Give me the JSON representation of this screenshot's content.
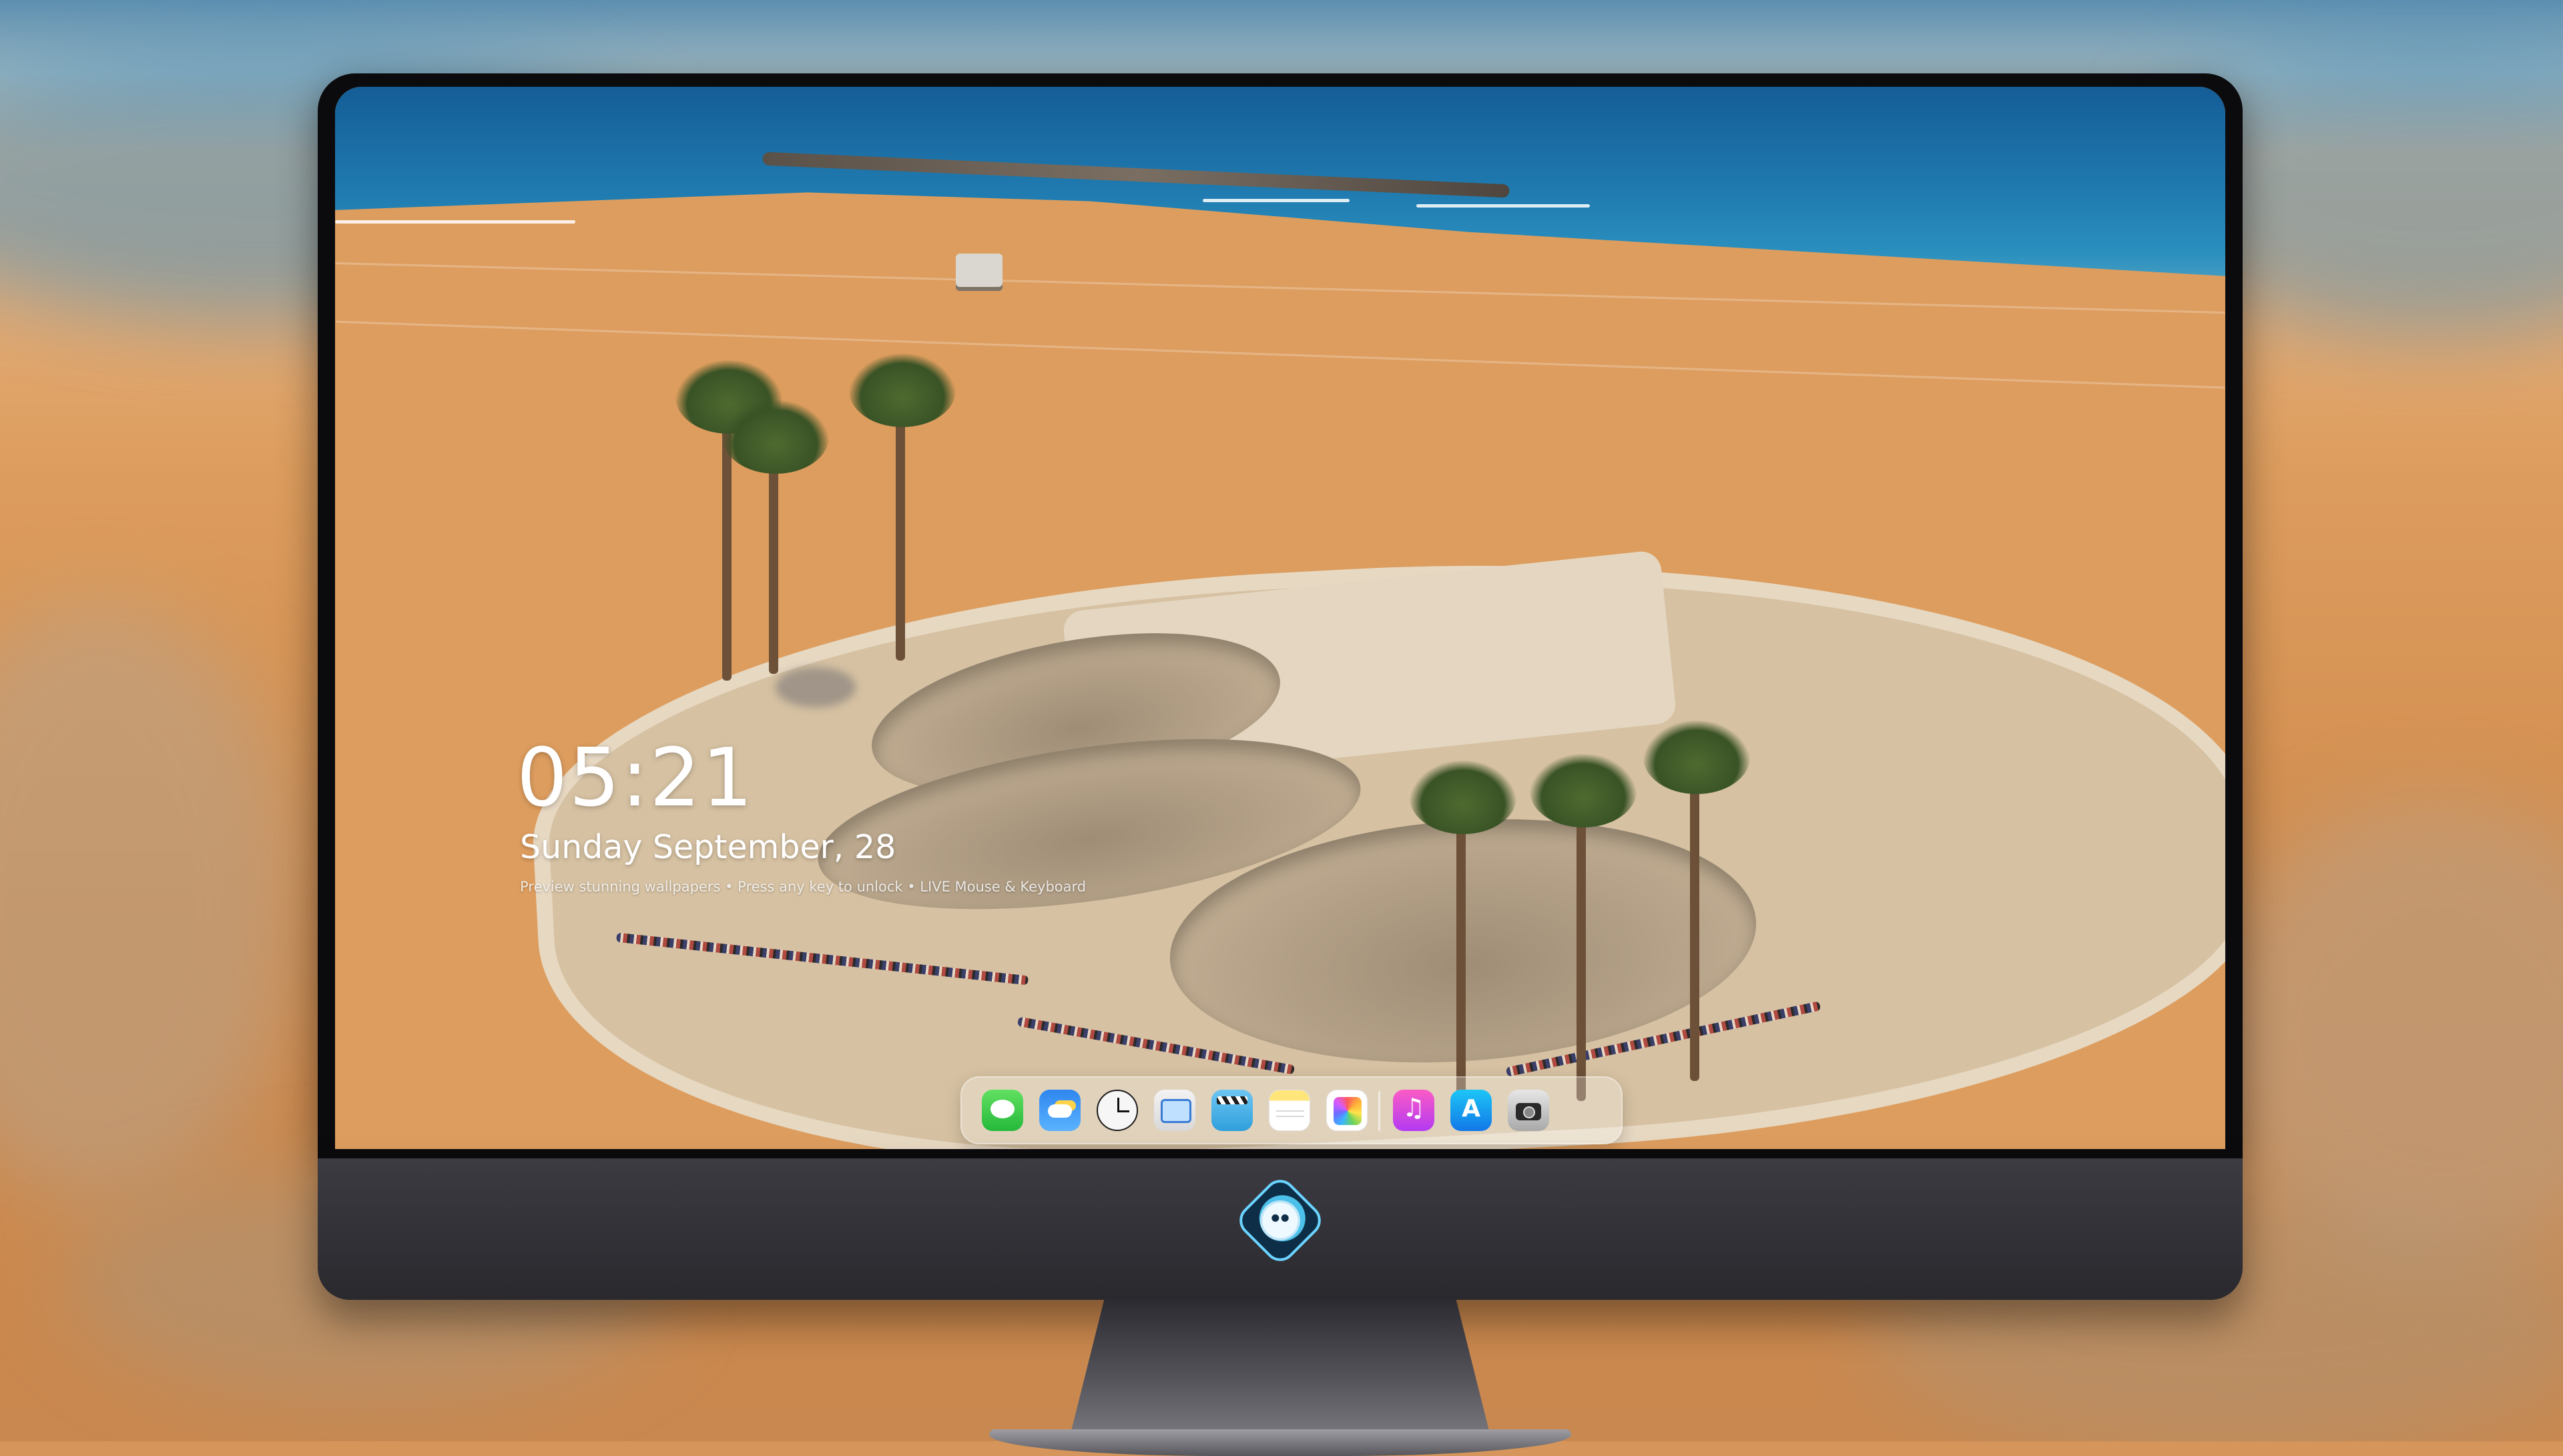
{
  "lock_screen": {
    "time": "05:21",
    "date": "Sunday September, 28",
    "hint": "Preview stunning wallpapers • Press any key to unlock • LIVE Mouse & Keyboard"
  },
  "dock": {
    "apps": [
      {
        "name": "Messages",
        "icon": "messages-icon"
      },
      {
        "name": "Weather",
        "icon": "weather-icon"
      },
      {
        "name": "Clock",
        "icon": "clock-icon"
      },
      {
        "name": "Preview",
        "icon": "preview-icon"
      },
      {
        "name": "Clips",
        "icon": "clapperboard-icon"
      },
      {
        "name": "Notes",
        "icon": "notes-icon"
      },
      {
        "name": "Photos",
        "icon": "photos-icon"
      },
      {
        "name": "Music",
        "icon": "music-icon"
      },
      {
        "name": "App Store",
        "icon": "app-store-icon"
      },
      {
        "name": "Camera",
        "icon": "camera-icon"
      }
    ]
  },
  "monitor": {
    "badge_icon": "wolf-mascot-logo-icon",
    "wallpaper": "beach-skatepark-aerial"
  },
  "colors": {
    "sand": "#dd9d5e",
    "sea": "#1f79ae",
    "bezel": "#0b0b0e",
    "chin": "#34333a",
    "logo_accent": "#4cc0ea"
  }
}
